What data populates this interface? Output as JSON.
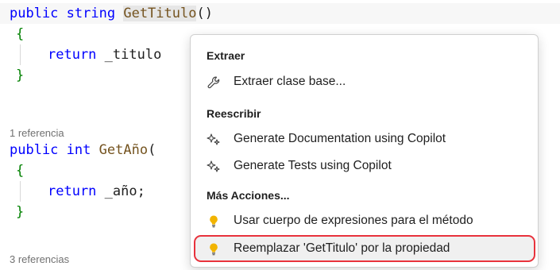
{
  "code": {
    "line1": {
      "kw1": "public",
      "kw2": "string",
      "fn": "GetTitulo",
      "rest": "()"
    },
    "line2": {
      "brace": "{"
    },
    "line3": {
      "kw": "return",
      "rest": "_titulo"
    },
    "line4": {
      "brace": "}"
    },
    "lens1": "1 referencia",
    "line5": {
      "kw1": "public",
      "kw2": "int",
      "fn": "GetAño",
      "rest": "("
    },
    "line6": {
      "brace": "{"
    },
    "line7": {
      "kw": "return",
      "rest": "_año;"
    },
    "line8": {
      "brace": "}"
    },
    "lens2": "3 referencias"
  },
  "menu": {
    "section_extract": "Extraer",
    "extract_base": "Extraer clase base...",
    "section_rewrite": "Reescribir",
    "gen_docs": "Generate Documentation using Copilot",
    "gen_tests": "Generate Tests using Copilot",
    "section_more": "Más Acciones...",
    "expr_body": "Usar cuerpo de expresiones para el método",
    "replace_prop": "Reemplazar 'GetTitulo' por la propiedad"
  },
  "colors": {
    "keyword": "#0000ff",
    "method": "#74531f",
    "brace": "#008000",
    "lightbulb": "#f2b400",
    "selection_outline": "#e8323c"
  },
  "icons": {
    "extract": "wrench-icon",
    "copilot": "sparkle-icon",
    "action": "lightbulb-icon"
  }
}
